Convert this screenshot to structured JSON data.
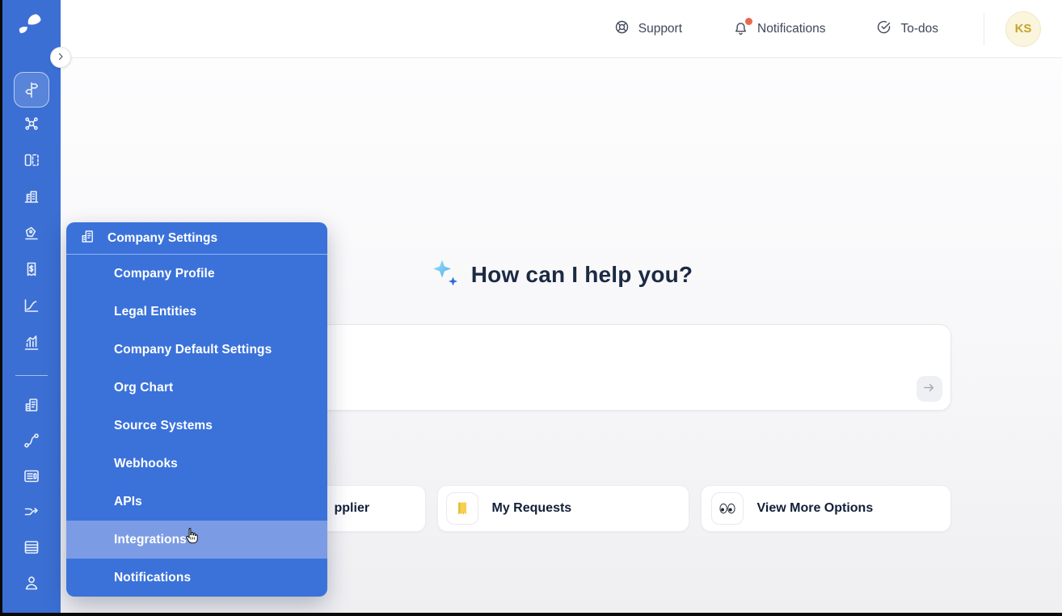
{
  "header": {
    "support_label": "Support",
    "notifications_label": "Notifications",
    "todos_label": "To-dos",
    "avatar_initials": "KS",
    "notification_dot_color": "#E9694F"
  },
  "sidebar": {
    "expand_icon": "chevron-right",
    "logo_icon": "leaf-logo",
    "selected_index": 0,
    "icons": [
      "signpost",
      "nodes-network",
      "layout-panels",
      "factory-building",
      "pen-tool",
      "invoice-dollar",
      "line-chart",
      "bar-chart",
      "office-documents",
      "route-workflow",
      "news-form",
      "split-arrows",
      "table-grid",
      "user-person"
    ]
  },
  "menu": {
    "title": "Company Settings",
    "title_icon": "company-building",
    "items": [
      "Company Profile",
      "Legal Entities",
      "Company Default Settings",
      "Org Chart",
      "Source Systems",
      "Webhooks",
      "APIs",
      "Integrations",
      "Notifications"
    ],
    "hovered_item": "Integrations"
  },
  "main": {
    "title": "How can I help you?",
    "title_icon": "sparkles",
    "input_value": "",
    "submit_icon": "arrow-right",
    "cards": [
      {
        "label": "pplier",
        "icon": "hidden-behind-menu"
      },
      {
        "label": "My Requests",
        "icon": "bookmark"
      },
      {
        "label": "View More Options",
        "icon": "eyes"
      }
    ]
  },
  "colors": {
    "sidebar_blue": "#3B6FD3",
    "menu_blue": "#3B72DA",
    "menu_hover_blue": "#7B9CE5",
    "avatar_bg": "#FAF5DC",
    "avatar_text": "#C6A42E",
    "title_text": "#1C2A44"
  }
}
